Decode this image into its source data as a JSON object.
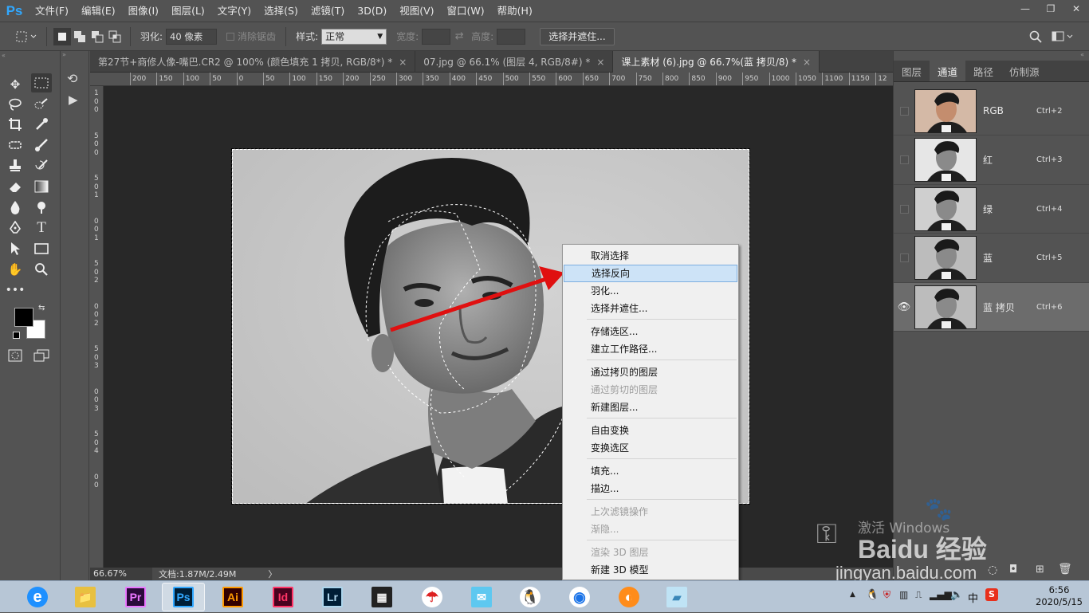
{
  "app": {
    "logo": "Ps",
    "window_controls": [
      "—",
      "❐",
      "✕"
    ]
  },
  "menu": [
    "文件(F)",
    "编辑(E)",
    "图像(I)",
    "图层(L)",
    "文字(Y)",
    "选择(S)",
    "滤镜(T)",
    "3D(D)",
    "视图(V)",
    "窗口(W)",
    "帮助(H)"
  ],
  "options": {
    "feather_label": "羽化:",
    "feather_value": "40 像素",
    "antialias_label": "消除锯齿",
    "style_label": "样式:",
    "style_value": "正常",
    "width_label": "宽度:",
    "height_label": "高度:",
    "refine_button": "选择并遮住..."
  },
  "tabs": [
    {
      "label": "第27节+商修人像-嘴巴.CR2 @ 100% (颜色填充 1 拷贝, RGB/8*) *",
      "close": "×",
      "active": false
    },
    {
      "label": "07.jpg @ 66.1% (图层 4, RGB/8#) *",
      "close": "×",
      "active": false
    },
    {
      "label": "课上素材 (6).jpg @ 66.7%(蓝 拷贝/8) *",
      "close": "×",
      "active": true
    }
  ],
  "ruler_h": [
    "200",
    "150",
    "100",
    "50",
    "0",
    "50",
    "100",
    "150",
    "200",
    "250",
    "300",
    "350",
    "400",
    "450",
    "500",
    "550",
    "600",
    "650",
    "700",
    "750",
    "800",
    "850",
    "900",
    "950",
    "1000",
    "1050",
    "1100",
    "1150",
    "12"
  ],
  "ruler_v": [
    "1",
    "0",
    "0",
    "5",
    "0",
    "0",
    "5",
    "0",
    "1",
    "0",
    "0",
    "1",
    "5",
    "0",
    "2",
    "0",
    "0",
    "2",
    "5",
    "0",
    "3",
    "0",
    "0",
    "3",
    "5",
    "0",
    "4",
    "0",
    "0"
  ],
  "status": {
    "zoom": "66.67%",
    "doc": "文档:1.87M/2.49M",
    "arrow": "〉"
  },
  "panel": {
    "tabs": [
      "图层",
      "通道",
      "路径",
      "仿制源"
    ],
    "active_tab": "通道",
    "channels": [
      {
        "name": "RGB",
        "shortcut": "Ctrl+2",
        "visible": false,
        "selected": false
      },
      {
        "name": "红",
        "shortcut": "Ctrl+3",
        "visible": false,
        "selected": false
      },
      {
        "name": "绿",
        "shortcut": "Ctrl+4",
        "visible": false,
        "selected": false
      },
      {
        "name": "蓝",
        "shortcut": "Ctrl+5",
        "visible": false,
        "selected": false
      },
      {
        "name": "蓝 拷贝",
        "shortcut": "Ctrl+6",
        "visible": true,
        "selected": true
      }
    ]
  },
  "context_menu": {
    "groups": [
      [
        {
          "label": "取消选择",
          "enabled": true
        },
        {
          "label": "选择反向",
          "enabled": true,
          "highlighted": true
        },
        {
          "label": "羽化...",
          "enabled": true
        },
        {
          "label": "选择并遮住...",
          "enabled": true
        }
      ],
      [
        {
          "label": "存储选区...",
          "enabled": true
        },
        {
          "label": "建立工作路径...",
          "enabled": true
        }
      ],
      [
        {
          "label": "通过拷贝的图层",
          "enabled": true
        },
        {
          "label": "通过剪切的图层",
          "enabled": false
        },
        {
          "label": "新建图层...",
          "enabled": true
        }
      ],
      [
        {
          "label": "自由变换",
          "enabled": true
        },
        {
          "label": "变换选区",
          "enabled": true
        }
      ],
      [
        {
          "label": "填充...",
          "enabled": true
        },
        {
          "label": "描边...",
          "enabled": true
        }
      ],
      [
        {
          "label": "上次滤镜操作",
          "enabled": false
        },
        {
          "label": "渐隐...",
          "enabled": false
        }
      ],
      [
        {
          "label": "渲染 3D 图层",
          "enabled": false
        },
        {
          "label": "新建 3D 模型",
          "enabled": true
        }
      ]
    ]
  },
  "taskbar": {
    "apps": [
      {
        "name": "browser",
        "label": "e",
        "color": "#1e90ff"
      },
      {
        "name": "explorer",
        "label": "📁",
        "color": "#e8c040"
      },
      {
        "name": "premiere",
        "label": "Pr",
        "color": "#2a0a3a",
        "fg": "#ea77ff"
      },
      {
        "name": "photoshop",
        "label": "Ps",
        "color": "#001e36",
        "fg": "#31a8ff",
        "active": true
      },
      {
        "name": "illustrator",
        "label": "Ai",
        "color": "#330000",
        "fg": "#ff9a00"
      },
      {
        "name": "indesign",
        "label": "Id",
        "color": "#49021f",
        "fg": "#ff3366"
      },
      {
        "name": "lightroom",
        "label": "Lr",
        "color": "#001e36",
        "fg": "#add5ec"
      },
      {
        "name": "video",
        "label": "▦",
        "color": "#222",
        "fg": "#eee"
      },
      {
        "name": "umbrella",
        "label": "☂",
        "color": "#fff",
        "fg": "#d22"
      },
      {
        "name": "chat",
        "label": "✉",
        "color": "#5ec8f0",
        "fg": "#fff"
      },
      {
        "name": "qq",
        "label": "🐧",
        "color": "#fff",
        "fg": "#000"
      },
      {
        "name": "chrome",
        "label": "◉",
        "color": "#fff",
        "fg": "#1a73e8"
      },
      {
        "name": "fox",
        "label": "◐",
        "color": "#ff8c1a",
        "fg": "#fff"
      },
      {
        "name": "notepad",
        "label": "▰",
        "color": "#bfe3f5",
        "fg": "#3a87b8"
      }
    ],
    "ime": "中",
    "time": "6:56",
    "date": "2020/5/15"
  },
  "watermark": {
    "activate": "激活 Windows",
    "brand": "Baidu 经验",
    "url": "jingyan.baidu.com"
  },
  "colors": {
    "accent": "#31a8ff",
    "arrow": "#e01010",
    "highlight": "#cde3f7"
  }
}
